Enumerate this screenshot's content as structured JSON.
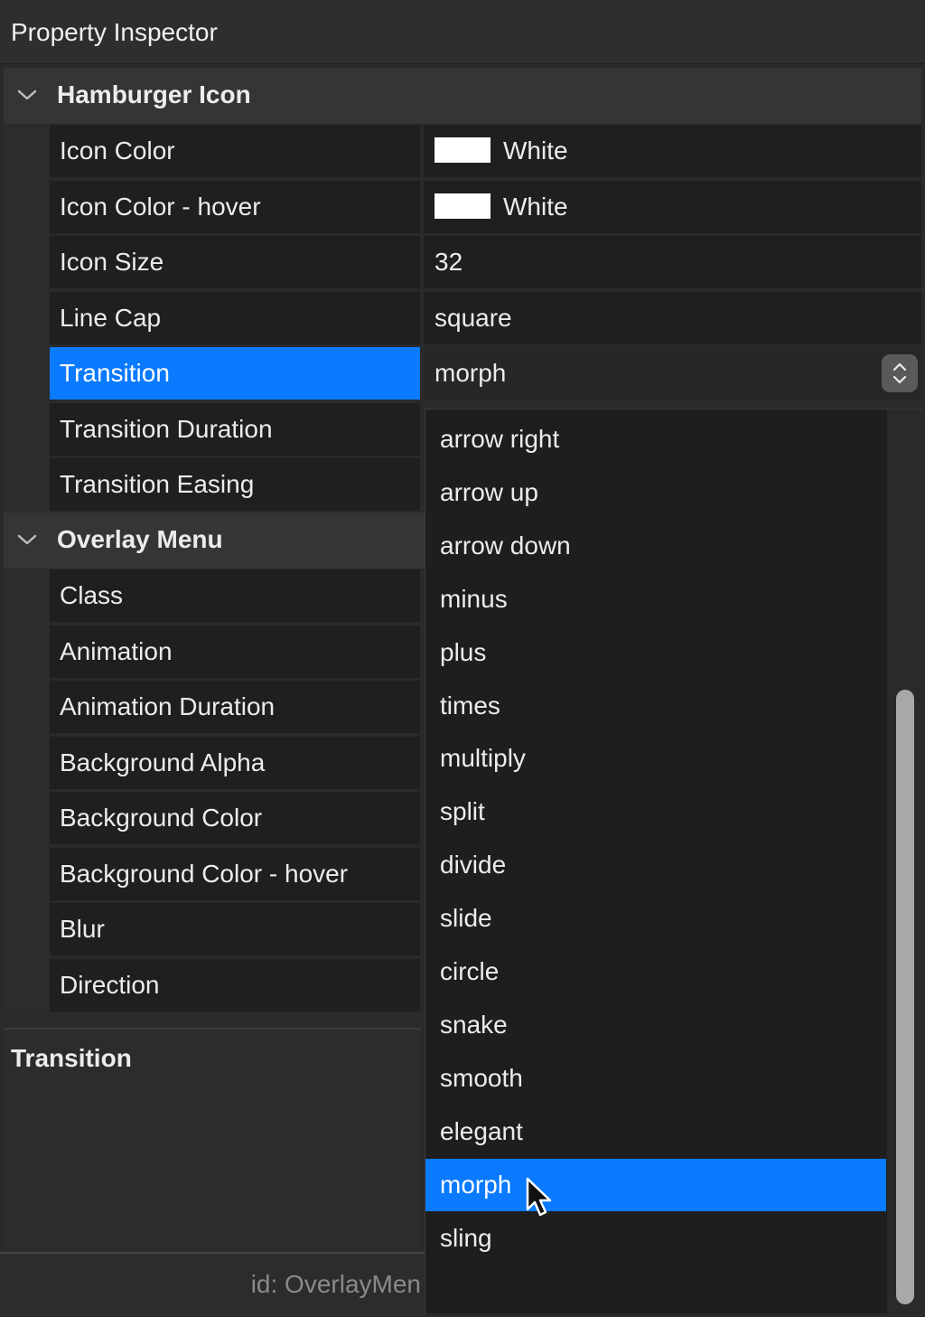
{
  "panel": {
    "title": "Property Inspector"
  },
  "sections": {
    "hamburger": {
      "label": "Hamburger Icon"
    },
    "overlay": {
      "label": "Overlay Menu"
    }
  },
  "properties": {
    "icon_color": {
      "name": "Icon Color",
      "value": "White",
      "swatch": "#ffffff"
    },
    "icon_color_hover": {
      "name": "Icon Color - hover",
      "value": "White",
      "swatch": "#ffffff"
    },
    "icon_size": {
      "name": "Icon Size",
      "value": "32"
    },
    "line_cap": {
      "name": "Line Cap",
      "value": "square"
    },
    "transition": {
      "name": "Transition",
      "value": "morph"
    },
    "transition_duration": {
      "name": "Transition Duration"
    },
    "transition_easing": {
      "name": "Transition Easing"
    },
    "class": {
      "name": "Class"
    },
    "animation": {
      "name": "Animation"
    },
    "animation_duration": {
      "name": "Animation Duration"
    },
    "background_alpha": {
      "name": "Background Alpha"
    },
    "background_color": {
      "name": "Background Color"
    },
    "background_color_hover": {
      "name": "Background Color - hover"
    },
    "blur": {
      "name": "Blur"
    },
    "direction": {
      "name": "Direction"
    }
  },
  "dropdown": {
    "options": [
      "arrow right",
      "arrow up",
      "arrow down",
      "minus",
      "plus",
      "times",
      "multiply",
      "split",
      "divide",
      "slide",
      "circle",
      "snake",
      "smooth",
      "elegant",
      "morph",
      "sling"
    ],
    "selected": "morph"
  },
  "help": {
    "title": "Transition"
  },
  "footer": {
    "id_text": "id: OverlayMen"
  },
  "colors": {
    "accent": "#0a7aff",
    "panel_bg": "#2a2a2a",
    "cell_bg": "#1f1f1f"
  }
}
